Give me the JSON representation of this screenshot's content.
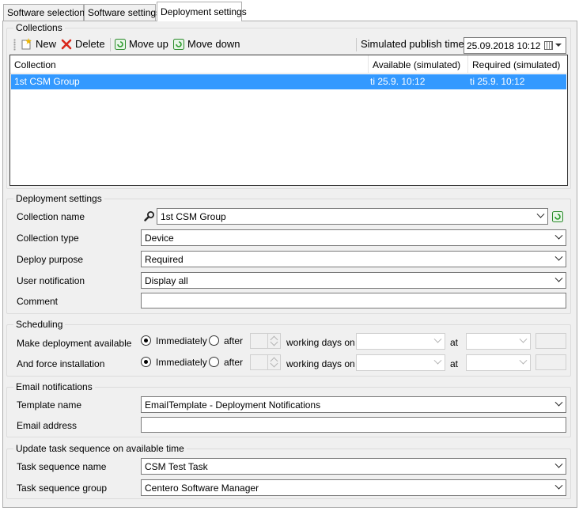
{
  "tabs": [
    "Software selection",
    "Software settings",
    "Deployment settings"
  ],
  "collections": {
    "title": "Collections",
    "toolbar": {
      "new_label": "New",
      "delete_label": "Delete",
      "move_up_label": "Move up",
      "move_down_label": "Move down",
      "publish_time_label": "Simulated publish time:",
      "publish_time_value": "25.09.2018 10:12"
    },
    "columns": [
      "Collection",
      "Available (simulated)",
      "Required (simulated)"
    ],
    "rows": [
      {
        "collection": "1st CSM Group",
        "available": "ti 25.9. 10:12",
        "required": "ti 25.9. 10:12"
      }
    ]
  },
  "deployment": {
    "title": "Deployment settings",
    "collection_name_label": "Collection name",
    "collection_name_value": "1st CSM Group",
    "collection_type_label": "Collection type",
    "collection_type_value": "Device",
    "deploy_purpose_label": "Deploy purpose",
    "deploy_purpose_value": "Required",
    "user_notification_label": "User notification",
    "user_notification_value": "Display all",
    "comment_label": "Comment",
    "comment_value": ""
  },
  "scheduling": {
    "title": "Scheduling",
    "available_label": "Make deployment available",
    "force_label": "And force installation",
    "immediately": "Immediately",
    "after": "after",
    "working_days_on": "working days on",
    "at": "at",
    "available_mode": "Immediately",
    "force_mode": "Immediately"
  },
  "email": {
    "title": "Email notifications",
    "template_label": "Template name",
    "template_value": "EmailTemplate - Deployment Notifications",
    "address_label": "Email address",
    "address_value": ""
  },
  "task_sequence": {
    "title": "Update task sequence on available time",
    "name_label": "Task sequence name",
    "name_value": "CSM Test Task",
    "group_label": "Task sequence group",
    "group_value": "Centero Software Manager"
  },
  "colors": {
    "selection": "#3399ff",
    "panel": "#f0f0f0",
    "delete_icon": "#d9281c",
    "refresh_icon": "#2c9a2c"
  },
  "icons": [
    "new-icon",
    "delete-icon",
    "move-up-icon",
    "move-down-icon",
    "calendar-icon",
    "search-icon",
    "refresh-icon"
  ]
}
